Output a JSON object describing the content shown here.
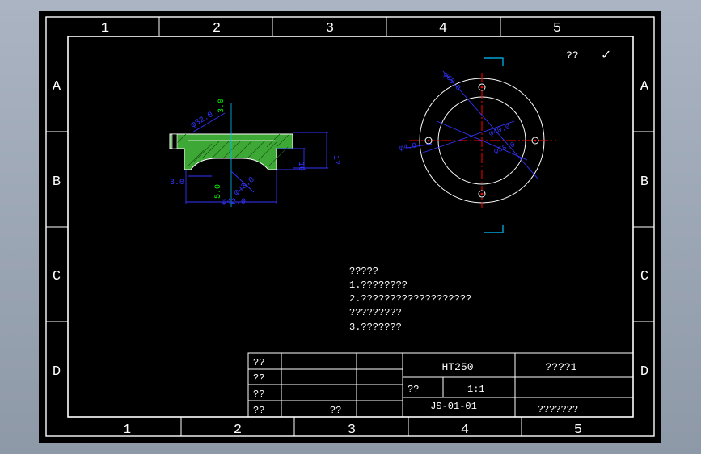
{
  "drawing": {
    "columns": [
      "1",
      "2",
      "3",
      "4",
      "5"
    ],
    "rows": [
      "A",
      "B",
      "C",
      "D"
    ],
    "roughness_label": "??",
    "roughness_mark": "✓"
  },
  "section_view": {
    "dims": [
      "φ32.0",
      "3.0",
      "17",
      "10",
      "3.0",
      "5.0",
      "φ42.0",
      "φ43.0"
    ]
  },
  "plan_view": {
    "dims": [
      "φ65.0",
      "φ40.0",
      "φ58.0",
      "φ4.0"
    ]
  },
  "notes": [
    "?????",
    "1.????????",
    "2.???????????????????",
    "?????????",
    "3.???????"
  ],
  "title_block": {
    "left_labels": [
      "??",
      "??",
      "??",
      "??"
    ],
    "left_mid": "??",
    "material": "HT250",
    "part_no": "????1",
    "scale_label": "??",
    "scale": "1:1",
    "drawing_no": "JS-01-01",
    "company": "???????"
  },
  "colors": {
    "background": "#000000",
    "frame": "#ffffff",
    "dimension": "#3333ff",
    "hatch_fill": "#3ea836",
    "centerline": "#ff0000",
    "accent_cyan": "#00bfff",
    "accent_green": "#00ff00",
    "page_border": "#a9b2c0"
  }
}
